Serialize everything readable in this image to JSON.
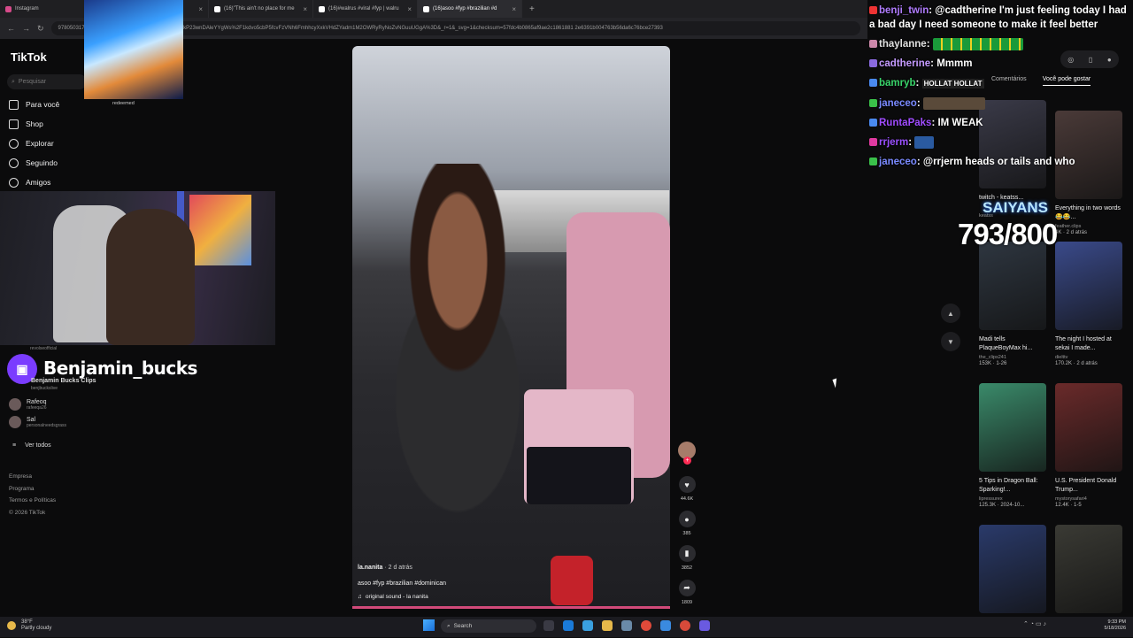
{
  "browser": {
    "tabs": [
      {
        "label": "Instagram",
        "icon": "instagram-icon"
      },
      {
        "label": "tiktok",
        "icon": "tiktok-icon"
      },
      {
        "label": "(16)\"This ain't no place for me",
        "icon": "tiktok-icon"
      },
      {
        "label": "(16)#walrus #viral #fyp | walru",
        "icon": "tiktok-icon"
      },
      {
        "label": "(16)asoo #fyp #brazilian #d",
        "icon": "tiktok-icon"
      }
    ],
    "new_tab": "+",
    "url": "9780503177_d=secCgYIASAHKAESPgo8OgzsvBl12kP23wnDAleYYgWs%2F1kdvo5cbP5fcvFzVNh6FmhhcyXxkVHdZYadm1M2OWRyRyNoZvNGuuUGgA%3D&_r=1&_svg=1&checksum=57fdc4b0865af9ae2c1861881 2e6391b004763b56da6c76bce27393"
  },
  "sidebar": {
    "logo": "TikTok",
    "search_placeholder": "Pesquisar",
    "nav": [
      {
        "label": "Para você",
        "icon": "home-icon"
      },
      {
        "label": "Shop",
        "icon": "shop-icon"
      },
      {
        "label": "Explorar",
        "icon": "compass-icon"
      },
      {
        "label": "Seguindo",
        "icon": "following-icon"
      },
      {
        "label": "Amigos",
        "icon": "friends-icon"
      }
    ],
    "following": [
      {
        "name": "Rafeoq",
        "sub": "rafeeqa26"
      },
      {
        "name": "Sal",
        "sub": "personalneedsgrass"
      }
    ],
    "see_all": "Ver todos",
    "footer": [
      "Empresa",
      "Programa",
      "Termos e Políticas",
      "© 2026 TikTok"
    ],
    "revolse": "revolseofficial"
  },
  "overlay": {
    "goku_caption": "redeemed",
    "streamer_name": "Benjamin_bucks",
    "clips_name": "Benjamin Bucks Clips",
    "clips_sub": "benjbuckslive",
    "saiyans": "SAIYANS",
    "counter": "793/800"
  },
  "video": {
    "username": "la.nanita",
    "time": "· 2 d atrás",
    "caption": "asoo #fyp #brazilian #dominican",
    "sound": "original sound - la nanita",
    "likes": "44.6K",
    "comments": "385",
    "saves": "3852",
    "shares": "1809"
  },
  "chat": [
    {
      "user": "benji_twin",
      "color": "#b07cff",
      "text": ": @cadtherine I'm just feeling today I had a bad day I need someone to make it feel better"
    },
    {
      "user": "thaylanne",
      "color": "#e0e0e0",
      "text": ":"
    },
    {
      "user": "cadtherine",
      "color": "#c49aff",
      "text": ": Mmmm"
    },
    {
      "user": "bamryb",
      "color": "#39d46a",
      "text": ":"
    },
    {
      "user": "janeceo",
      "color": "#7a8aff",
      "text": ":"
    },
    {
      "user": "RuntaPaks",
      "color": "#a04cff",
      "text": ": IM WEAK"
    },
    {
      "user": "rrjerm",
      "color": "#9a50ff",
      "text": ":"
    },
    {
      "user": "janeceo",
      "color": "#7a8aff",
      "text": ": @rrjerm heads or tails and who"
    }
  ],
  "emotes": {
    "bamryb": "HOLLAT HOLLAT"
  },
  "right_panel": {
    "tabs": [
      "Comentários",
      "Você pode gostar"
    ],
    "cards": [
      {
        "title": "twitch - keatss...",
        "meta": "keatss",
        "stats": "",
        "color": "#3a3a48"
      },
      {
        "title": "Everything in two words 😂😂...",
        "meta": "feather.clips",
        "stats": "4K · 2 d atrás",
        "color": "#4a3a38"
      },
      {
        "title": "Madi tells PlaqueBoyMax hi...",
        "meta": "the_clips241",
        "stats": "153K · 1-26",
        "color": "#2e3640"
      },
      {
        "title": "The night I hosted at sekai I made...",
        "meta": "dielttv",
        "stats": "170.2K · 2 d atrás",
        "color": "#3a4a8a"
      },
      {
        "title": "5 Tips in Dragon Ball: Sparking!...",
        "meta": "lipressurex",
        "stats": "125.3K · 2024-10...",
        "color": "#3a8a6a"
      },
      {
        "title": "U.S. President Donald Trump...",
        "meta": "mystorysafari4",
        "stats": "12.4K · 1-5",
        "color": "#6a2a2a"
      },
      {
        "title": "",
        "meta": "",
        "stats": "",
        "color": "#2a3a6a"
      },
      {
        "title": "",
        "meta": "",
        "stats": "",
        "color": "#3a3a34"
      }
    ]
  },
  "taskbar": {
    "temp": "38°F",
    "weather": "Partly cloudy",
    "search": "Search",
    "time": "9:33 PM",
    "date": "5/18/2026"
  }
}
